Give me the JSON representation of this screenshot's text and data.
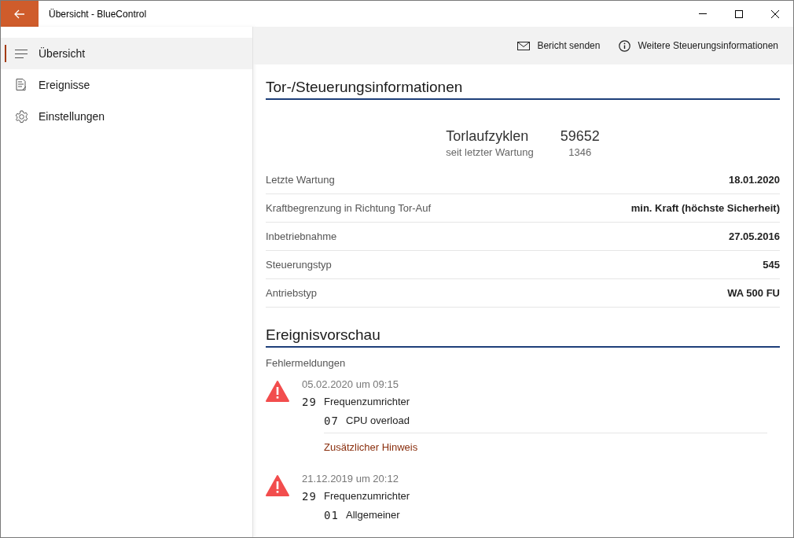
{
  "window": {
    "title": "Übersicht - BlueControl"
  },
  "sidebar": {
    "items": [
      {
        "label": "Übersicht",
        "selected": true
      },
      {
        "label": "Ereignisse",
        "selected": false
      },
      {
        "label": "Einstellungen",
        "selected": false
      }
    ]
  },
  "toolbar": {
    "actions": [
      {
        "label": "Bericht senden"
      },
      {
        "label": "Weitere Steuerungsinformationen"
      }
    ]
  },
  "info_section": {
    "heading": "Tor-/Steuerungsinformationen",
    "cycles": {
      "label": "Torlaufzyklen",
      "value": "59652",
      "sub_label": "seit letzter Wartung",
      "sub_value": "1346"
    },
    "rows": [
      {
        "label": "Letzte Wartung",
        "value": "18.01.2020"
      },
      {
        "label": "Kraftbegrenzung in Richtung Tor-Auf",
        "value": "min. Kraft (höchste Sicherheit)"
      },
      {
        "label": "Inbetriebnahme",
        "value": "27.05.2016"
      },
      {
        "label": "Steuerungstyp",
        "value": "545"
      },
      {
        "label": "Antriebstyp",
        "value": "WA 500 FU"
      }
    ]
  },
  "events_section": {
    "heading": "Ereignisvorschau",
    "subheading": "Fehlermeldungen",
    "events": [
      {
        "datetime": "05.02.2020 um 09:15",
        "module_code": "29",
        "module": "Frequenzumrichter",
        "error_code": "07",
        "error": "CPU overload",
        "link": "Zusätzlicher Hinweis"
      },
      {
        "datetime": "21.12.2019 um 20:12",
        "module_code": "29",
        "module": "Frequenzumrichter",
        "error_code": "01",
        "error": "Allgemeiner"
      }
    ]
  }
}
